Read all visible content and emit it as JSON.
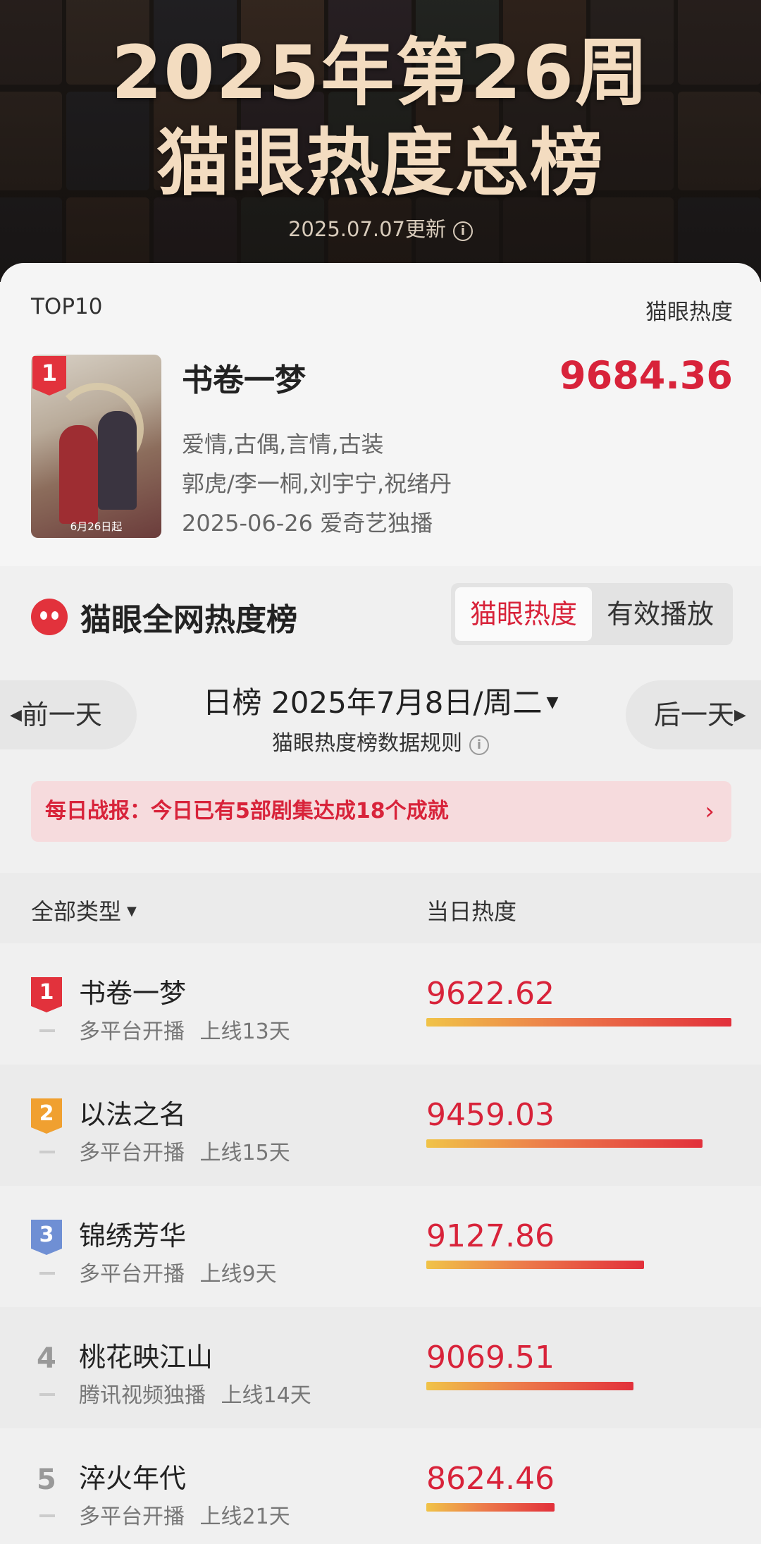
{
  "hero": {
    "title_line1": "2025年第26周",
    "title_line2": "猫眼热度总榜",
    "update_text": "2025.07.07更新"
  },
  "top_card": {
    "label_left": "TOP10",
    "label_right": "猫眼热度",
    "rank": "1",
    "cover_date": "6月26日起",
    "title": "书卷一梦",
    "score": "9684.36",
    "genres": "爱情,古偶,言情,古装",
    "cast": "郭虎/李一桐,刘宇宁,祝绪丹",
    "release": "2025-06-26 爱奇艺独播"
  },
  "panel": {
    "brand": "猫眼全网热度榜",
    "seg_active": "猫眼热度",
    "seg_other": "有效播放",
    "prev_day": "前一天",
    "next_day": "后一天",
    "day_label": "日榜",
    "date": "2025年7月8日/周二",
    "rules": "猫眼热度榜数据规则",
    "report": "每日战报：今日已有5部剧集达成18个成就",
    "col_type": "全部类型",
    "col_heat": "当日热度"
  },
  "list": [
    {
      "rank": "1",
      "name": "书卷一梦",
      "sub": "多平台开播 上线13天",
      "value": 9622.62
    },
    {
      "rank": "2",
      "name": "以法之名",
      "sub": "多平台开播 上线15天",
      "value": 9459.03
    },
    {
      "rank": "3",
      "name": "锦绣芳华",
      "sub": "多平台开播 上线9天",
      "value": 9127.86
    },
    {
      "rank": "4",
      "name": "桃花映江山",
      "sub": "腾讯视频独播 上线14天",
      "value": 9069.51
    },
    {
      "rank": "5",
      "name": "淬火年代",
      "sub": "多平台开播 上线21天",
      "value": 8624.46
    }
  ],
  "colors": {
    "accent": "#d8233a",
    "rank1": "#e2323c",
    "rank2": "#f0a030",
    "rank3": "#6f8fd4",
    "hero_text": "#f3dcc0"
  },
  "icons": [
    "info-icon",
    "maoyan-cat-logo-icon",
    "caret-down-icon",
    "arrow-left-icon",
    "arrow-right-icon",
    "chevron-right-icon",
    "rank-flag-icon"
  ]
}
